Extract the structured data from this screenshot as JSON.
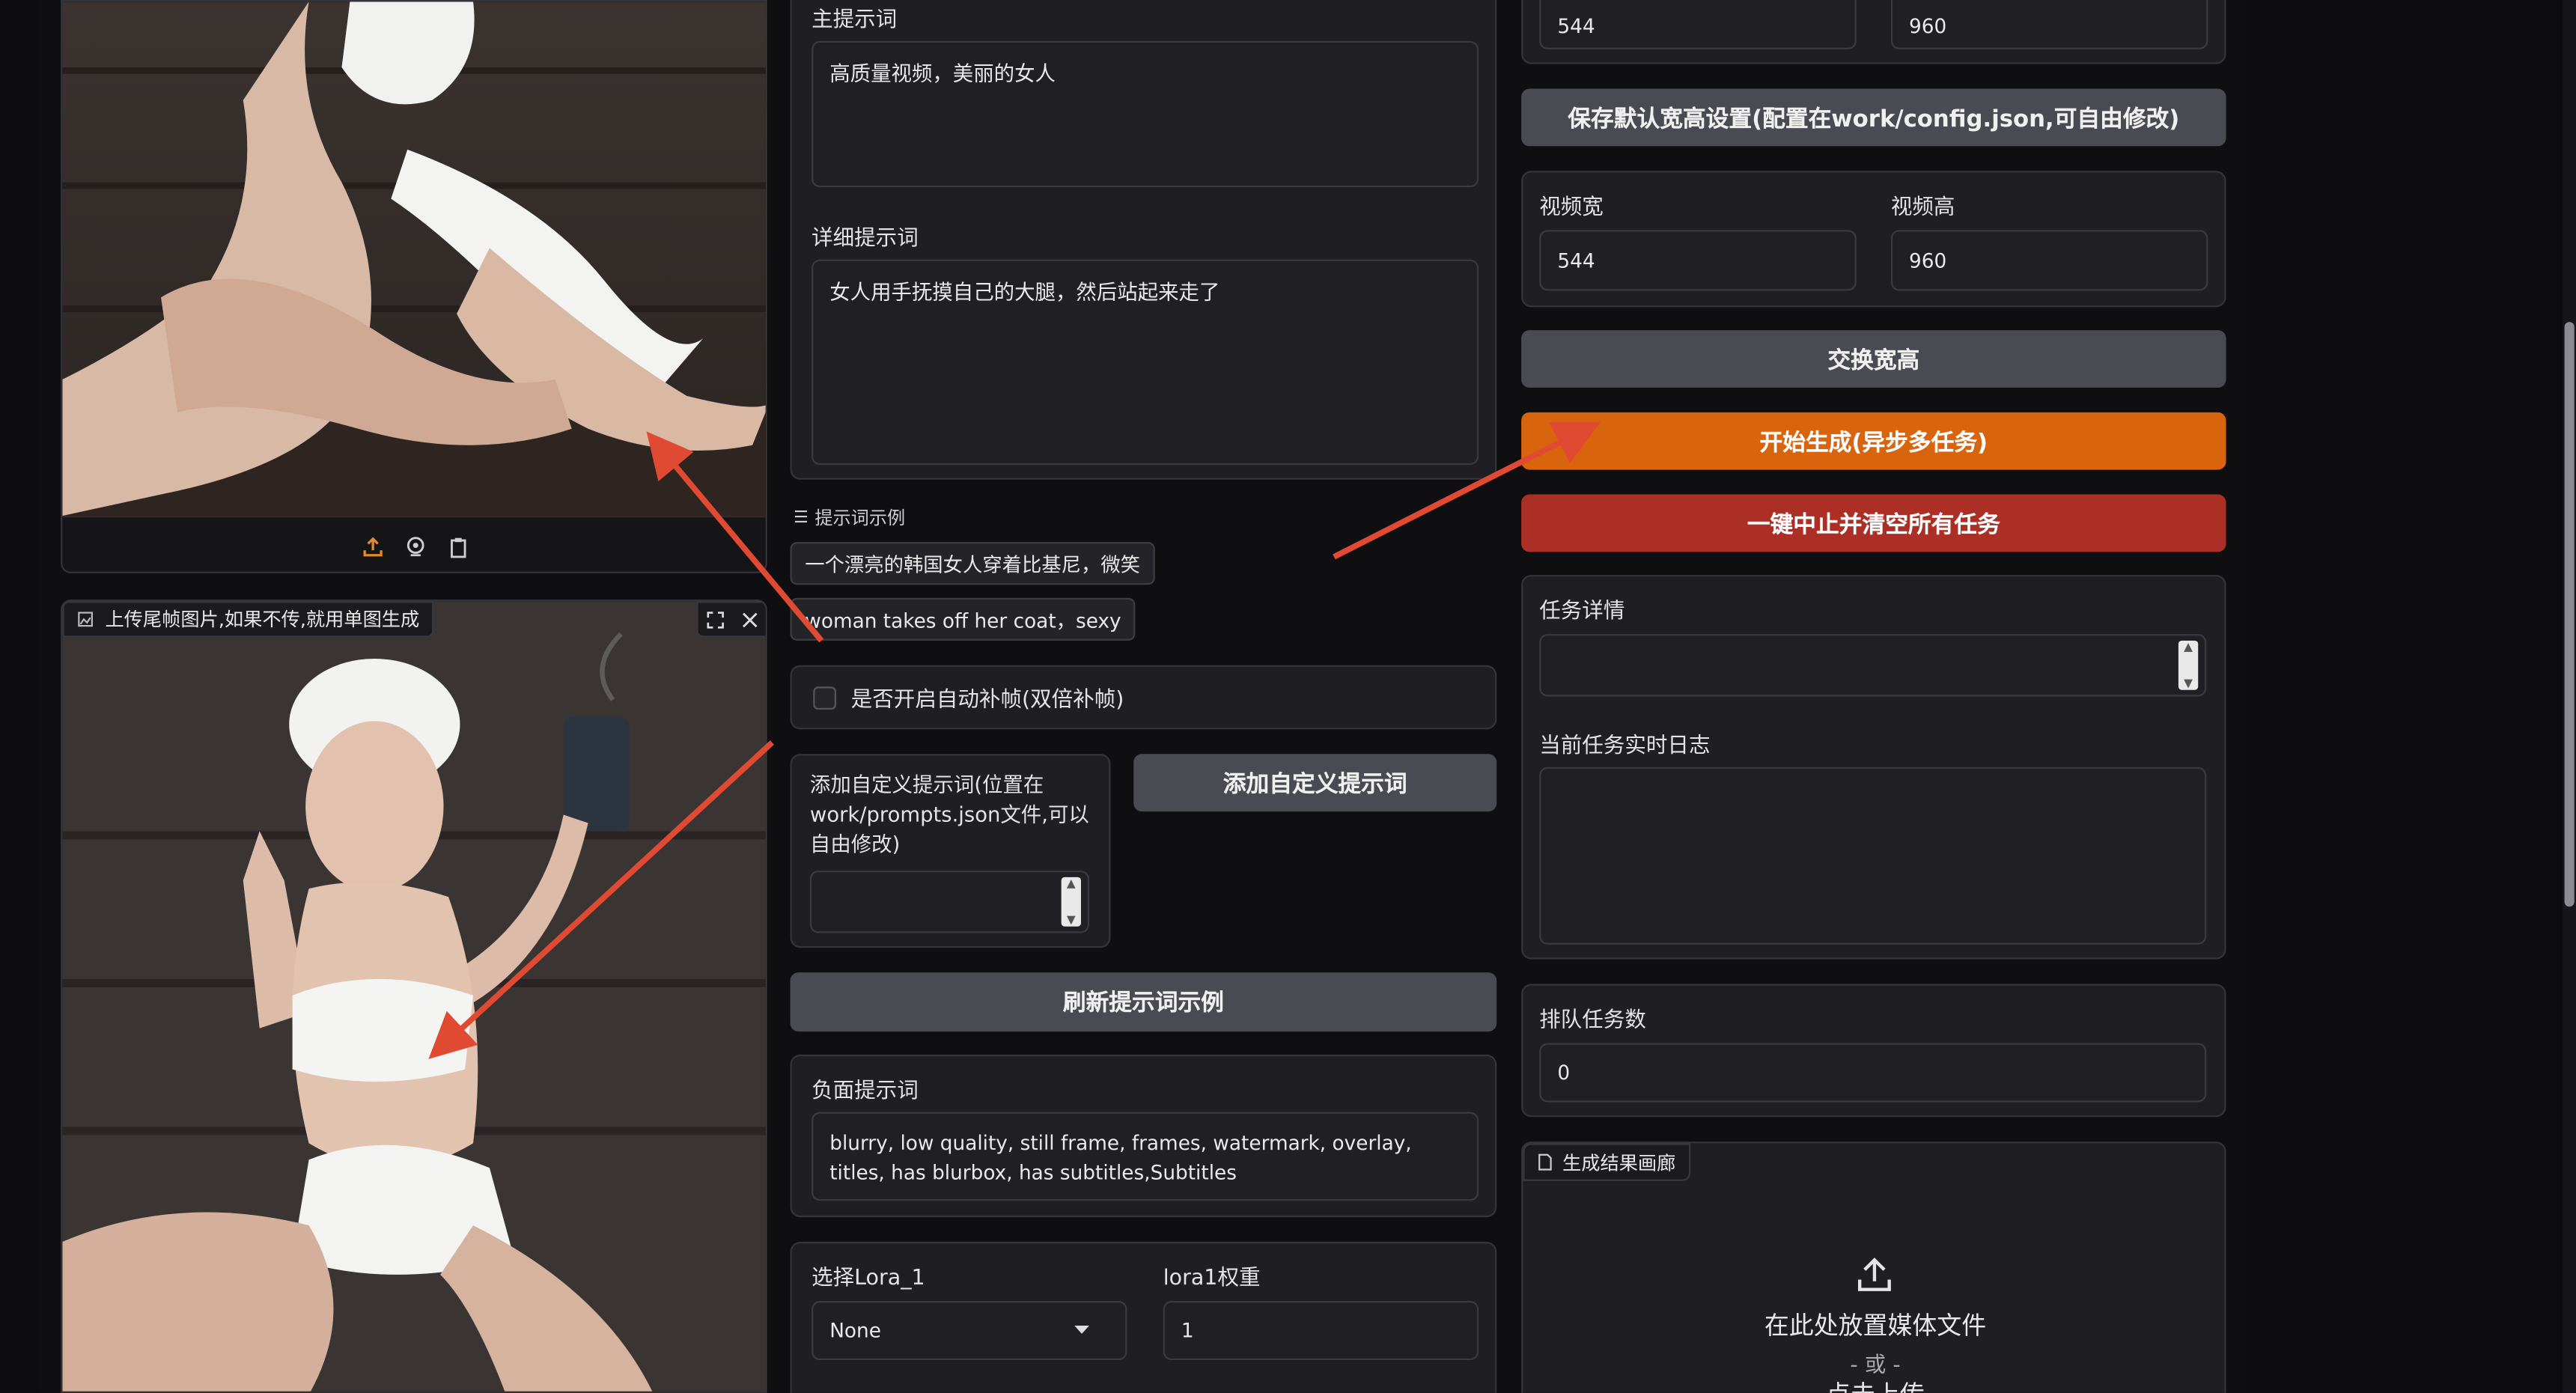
{
  "upload_panel": {
    "end_frame_label": "上传尾帧图片,如果不传,就用单图生成",
    "icons": [
      "upload-icon",
      "webcam-icon",
      "clipboard-icon",
      "fullscreen-icon",
      "close-icon",
      "image-icon"
    ]
  },
  "prompts": {
    "main_label": "主提示词",
    "main_value": "高质量视频，美丽的女人",
    "detail_label": "详细提示词",
    "detail_value": "女人用手抚摸自己的大腿，然后站起来走了",
    "examples_label": "提示词示例",
    "examples": [
      "一个漂亮的韩国女人穿着比基尼，微笑",
      "woman takes off her coat，sexy"
    ],
    "auto_interp_label": "是否开启自动补帧(双倍补帧)",
    "custom_label": "添加自定义提示词(位置在work/prompts.json文件,可以自由修改)",
    "custom_value": "",
    "add_custom_button": "添加自定义提示词",
    "refresh_button": "刷新提示词示例",
    "negative_label": "负面提示词",
    "negative_value": "blurry, low quality, still frame, frames, watermark, overlay, titles, has blurbox, has subtitles,Subtitles",
    "lora_label": "选择Lora_1",
    "lora_value": "None",
    "lora_weight_label": "lora1权重",
    "lora_weight_value": "1"
  },
  "settings": {
    "default_width": "544",
    "default_height": "960",
    "save_default_button": "保存默认宽高设置(配置在work/config.json,可自由修改)",
    "video_width_label": "视频宽",
    "video_width": "544",
    "video_height_label": "视频高",
    "video_height": "960",
    "swap_button": "交换宽高",
    "start_button": "开始生成(异步多任务)",
    "stop_button": "一键中止并清空所有任务",
    "task_detail_label": "任务详情",
    "task_detail_value": "",
    "log_label": "当前任务实时日志",
    "log_value": "",
    "queue_label": "排队任务数",
    "queue_value": "0",
    "gallery_label": "生成结果画廊",
    "drop_text": "在此处放置媒体文件",
    "or_text": "- 或 -",
    "click_upload": "点击上传"
  },
  "colors": {
    "accent": "#d9640e",
    "danger": "#ab2f24",
    "annotation": "#e04a32"
  }
}
